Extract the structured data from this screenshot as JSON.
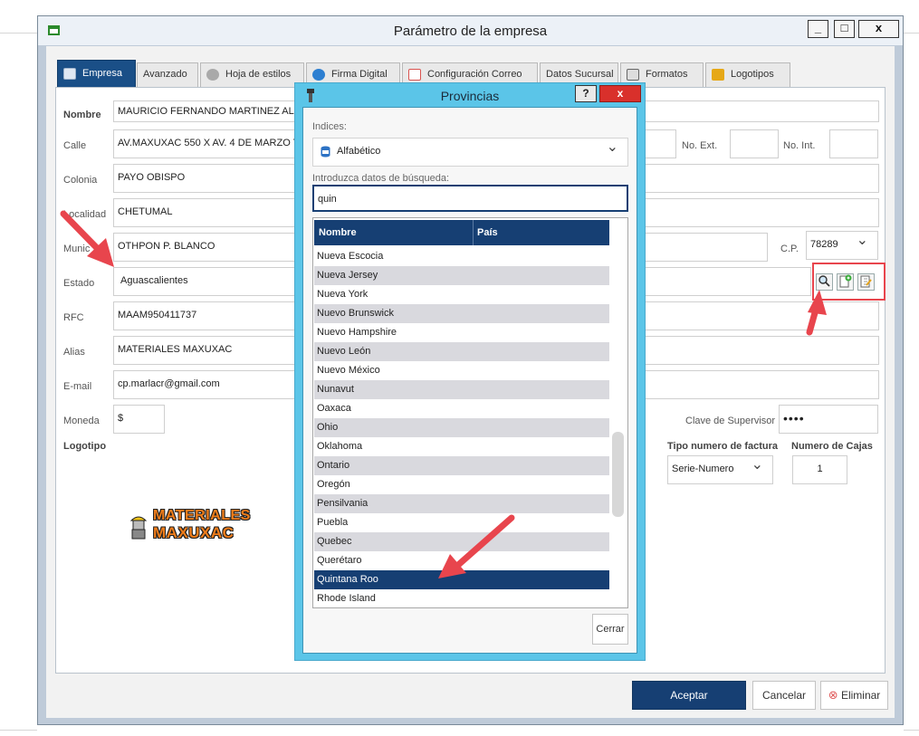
{
  "window": {
    "title": "Parámetro de la empresa",
    "controls": {
      "minimize": "_",
      "maximize": "□",
      "close": "x"
    }
  },
  "tabs": [
    {
      "label": "Empresa"
    },
    {
      "label": "Avanzado"
    },
    {
      "label": "Hoja de estilos"
    },
    {
      "label": "Firma Digital"
    },
    {
      "label": "Configuración Correo"
    },
    {
      "label": "Datos Sucursal"
    },
    {
      "label": "Formatos"
    },
    {
      "label": "Logotipos"
    }
  ],
  "form": {
    "nombre_label": "Nombre",
    "nombre_value": "MAURICIO FERNANDO MARTINEZ ALBAR",
    "calle_label": "Calle",
    "calle_value": "AV.MAXUXAC 550 X AV. 4 DE MARZO Y A",
    "no_ext_label": "No. Ext.",
    "no_int_label": "No. Int.",
    "colonia_label": "Colonia",
    "colonia_value": "PAYO OBISPO",
    "localidad_label": "Localidad",
    "localidad_value": "CHETUMAL",
    "municipio_label": "Munic",
    "municipio_value": "OTHPON P. BLANCO",
    "cp_label": "C.P.",
    "cp_value": "78289",
    "estado_label": "Estado",
    "estado_value": "Aguascalientes",
    "rfc_label": "RFC",
    "rfc_value": "MAAM950411737",
    "alias_label": "Alias",
    "alias_value": "MATERIALES MAXUXAC",
    "email_label": "E-mail",
    "email_value": "cp.marlacr@gmail.com",
    "moneda_label": "Moneda",
    "moneda_value": "$",
    "clave_supervisor_label": "Clave de Supervisor",
    "clave_supervisor_value": "••••",
    "logotipo_label": "Logotipo",
    "tipo_factura_label": "Tipo numero de factura",
    "tipo_factura_value": "Serie-Numero",
    "numero_cajas_label": "Numero de Cajas",
    "numero_cajas_value": "1"
  },
  "logo": {
    "line1": "MATERIALES",
    "line2": "MAXUXAC",
    "color": "#f07d1a"
  },
  "buttons": {
    "aceptar": "Aceptar",
    "cancelar": "Cancelar",
    "eliminar": "Eliminar"
  },
  "dialog": {
    "title": "Provincias",
    "help": "?",
    "close": "x",
    "indices_label": "Indices:",
    "indices_value": "Alfabético",
    "search_label": "Introduzca datos de búsqueda:",
    "search_value": "quin",
    "columns": [
      "Nombre",
      "País"
    ],
    "rows": [
      "Nueva Escocia",
      "Nueva Jersey",
      "Nueva York",
      "Nuevo Brunswick",
      "Nuevo Hampshire",
      "Nuevo León",
      "Nuevo México",
      "Nunavut",
      "Oaxaca",
      "Ohio",
      "Oklahoma",
      "Ontario",
      "Oregón",
      "Pensilvania",
      "Puebla",
      "Quebec",
      "Querétaro",
      "Quintana Roo",
      "Rhode Island"
    ],
    "selected_row": "Quintana Roo",
    "cerrar": "Cerrar"
  },
  "colors": {
    "accent": "#163f73",
    "dialog_frame": "#5bc5e8",
    "annotation": "#e8454d"
  }
}
